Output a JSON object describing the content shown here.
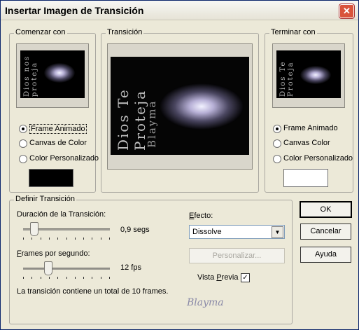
{
  "window": {
    "title": "Insertar Imagen de Transición",
    "close_glyph": "✕"
  },
  "start": {
    "group_label": "Comenzar con",
    "options": [
      "Frame Animado",
      "Canvas de Color",
      "Color Personalizado"
    ],
    "selected": 0,
    "swatch_color": "#000000",
    "image_text": "Dios nos proteja"
  },
  "transition": {
    "group_label": "Transición",
    "image_text_left": "Dios Te Proteja",
    "image_text_right": "Blayma"
  },
  "end": {
    "group_label": "Terminar con",
    "options": [
      "Frame Animado",
      "Canvas Color",
      "Color Personalizado"
    ],
    "selected": 0,
    "swatch_color": "#ffffff",
    "image_text": "Dios Te Proteja"
  },
  "define": {
    "group_label": "Definir Transición",
    "duration_label": "Duración de la Transición:",
    "duration_value": "0,9 segs",
    "duration_level": 0.12,
    "fps_label": "Frames por segundo:",
    "fps_value": "12 fps",
    "fps_level": 0.28,
    "summary": "La transición contiene un total de 10 frames.",
    "effect_label": "Efecto:",
    "effect_value": "Dissolve",
    "customize_label": "Personalizar...",
    "preview_label": "Vista Previa",
    "preview_checked": true,
    "watermark": "Blayma"
  },
  "buttons": {
    "ok": "OK",
    "cancel": "Cancelar",
    "help": "Ayuda"
  }
}
